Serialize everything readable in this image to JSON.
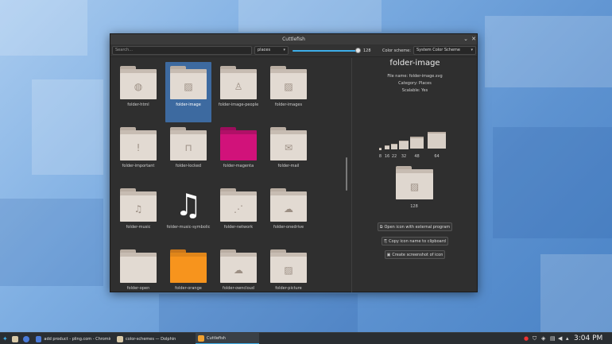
{
  "window": {
    "title": "Cuttlefish"
  },
  "toolbar": {
    "search_placeholder": "Search...",
    "category_value": "places",
    "size_value": "128",
    "size_fraction": 1.0,
    "color_scheme_label": "Color scheme:",
    "color_scheme_value": "System Color Scheme"
  },
  "icons": [
    {
      "name": "folder-html",
      "glyph": "globe-icon",
      "color": "#d8cfc6"
    },
    {
      "name": "folder-image",
      "glyph": "image-icon",
      "color": "#d8cfc6",
      "selected": true
    },
    {
      "name": "folder-image-people",
      "glyph": "person-icon",
      "color": "#d8cfc6"
    },
    {
      "name": "folder-images",
      "glyph": "image-icon",
      "color": "#d8cfc6"
    },
    {
      "name": "folder-important",
      "glyph": "exclamation-icon",
      "color": "#d8cfc6"
    },
    {
      "name": "folder-locked",
      "glyph": "lock-icon",
      "color": "#d8cfc6"
    },
    {
      "name": "folder-magenta",
      "glyph": "",
      "color": "#d1127a"
    },
    {
      "name": "folder-mail",
      "glyph": "envelope-icon",
      "color": "#d8cfc6"
    },
    {
      "name": "folder-music",
      "glyph": "note-icon",
      "color": "#d8cfc6"
    },
    {
      "name": "folder-music-symbolic",
      "glyph": "note-symbolic-icon",
      "color": "#ffffff"
    },
    {
      "name": "folder-network",
      "glyph": "network-icon",
      "color": "#d8cfc6"
    },
    {
      "name": "folder-onedrive",
      "glyph": "cloud-icon",
      "color": "#d8cfc6"
    },
    {
      "name": "folder-open",
      "glyph": "",
      "color": "#d8cfc6"
    },
    {
      "name": "folder-orange",
      "glyph": "",
      "color": "#f7941d"
    },
    {
      "name": "folder-owncloud",
      "glyph": "cloud-icon",
      "color": "#d8cfc6"
    },
    {
      "name": "folder-picture",
      "glyph": "image-icon",
      "color": "#d8cfc6"
    }
  ],
  "details": {
    "title": "folder-image",
    "file_name": "File name: folder-image.svg",
    "category": "Category: Places",
    "scalable": "Scalable: Yes",
    "sizes": [
      "8",
      "16",
      "22",
      "32",
      "48",
      "64"
    ],
    "big_size": "128",
    "buttons": {
      "open_external": "Open icon with external program",
      "copy_name": "Copy icon name to clipboard",
      "screenshot": "Create screenshot of icon"
    }
  },
  "taskbar": {
    "items": [
      {
        "label": "add product - pling.com - Chromiu...",
        "color": "#4b7bd8"
      },
      {
        "label": "color-schemes — Dolphin",
        "color": "#d8c9a8"
      },
      {
        "label": "Cuttlefish",
        "color": "#f0a030"
      }
    ],
    "clock": "3:04 PM"
  },
  "colors": {
    "accent": "#3daee9",
    "selection": "#3d6aa0",
    "folder": "#d8cfc6"
  }
}
